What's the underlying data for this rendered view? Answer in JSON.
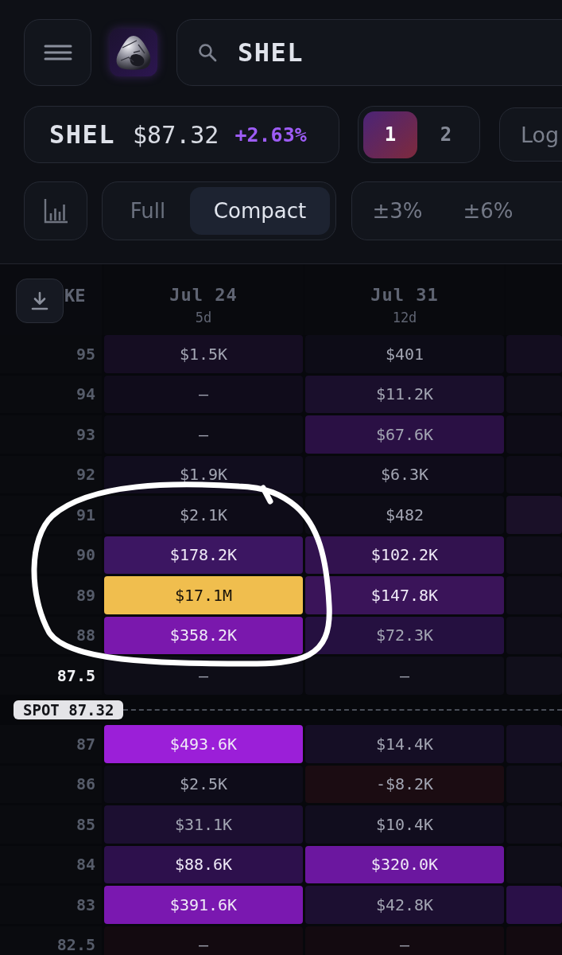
{
  "search": {
    "value": "SHEL"
  },
  "quote": {
    "symbol": "SHEL",
    "price": "$87.32",
    "change": "+2.63%"
  },
  "pages": [
    {
      "label": "1",
      "selected": true
    },
    {
      "label": "2",
      "selected": false
    }
  ],
  "header_button": {
    "label": "Log"
  },
  "view_modes": [
    {
      "label": "Full",
      "selected": false
    },
    {
      "label": "Compact",
      "selected": true
    }
  ],
  "ranges": [
    {
      "label": "±3%",
      "selected": false
    },
    {
      "label": "±6%",
      "selected": false
    }
  ],
  "table": {
    "strike_header": "KE",
    "columns": [
      {
        "date": "Jul 24",
        "days": "5d"
      },
      {
        "date": "Jul 31",
        "days": "12d"
      }
    ],
    "rows": [
      {
        "kind": "strike",
        "strike": "95",
        "highlighted": false,
        "cells": [
          {
            "value": "$1.5K",
            "color": "#150d22"
          },
          {
            "value": "$401",
            "color": "#0d0c17"
          },
          {
            "color": "#130d1f"
          }
        ]
      },
      {
        "kind": "strike",
        "strike": "94",
        "highlighted": false,
        "cells": [
          {
            "value": "—",
            "color": "#100c1b"
          },
          {
            "value": "$11.2K",
            "color": "#1a0f2c"
          },
          {
            "color": "#0f0d18"
          }
        ]
      },
      {
        "kind": "strike",
        "strike": "93",
        "highlighted": false,
        "cells": [
          {
            "value": "—",
            "color": "#0d0c16"
          },
          {
            "value": "$67.6K",
            "color": "#2a1044"
          },
          {
            "color": "#0e0c17"
          }
        ]
      },
      {
        "kind": "strike",
        "strike": "92",
        "highlighted": false,
        "cells": [
          {
            "value": "$1.9K",
            "color": "#110d1e"
          },
          {
            "value": "$6.3K",
            "color": "#0f0c1a"
          },
          {
            "color": "#0e0c17"
          }
        ]
      },
      {
        "kind": "strike",
        "strike": "91",
        "highlighted": false,
        "cells": [
          {
            "value": "$2.1K",
            "color": "#0e0c18"
          },
          {
            "value": "$482",
            "color": "#0d0c16"
          },
          {
            "color": "#1a1028"
          }
        ]
      },
      {
        "kind": "strike",
        "strike": "90",
        "highlighted": false,
        "cells": [
          {
            "value": "$178.2K",
            "color": "#3c1662"
          },
          {
            "value": "$102.2K",
            "color": "#32124f"
          },
          {
            "color": "#0f0d18"
          }
        ]
      },
      {
        "kind": "strike",
        "strike": "89",
        "highlighted": false,
        "cells": [
          {
            "value": "$17.1M",
            "color": "#f0be4e"
          },
          {
            "value": "$147.8K",
            "color": "#3a1459"
          },
          {
            "color": "#0f0d18"
          }
        ]
      },
      {
        "kind": "strike",
        "strike": "88",
        "highlighted": false,
        "cells": [
          {
            "value": "$358.2K",
            "color": "#7a18ad"
          },
          {
            "value": "$72.3K",
            "color": "#251040"
          },
          {
            "color": "#0f0d18"
          }
        ]
      },
      {
        "kind": "strike",
        "strike": "87.5",
        "highlighted": true,
        "cells": [
          {
            "value": "—",
            "color": "#0e0d17"
          },
          {
            "value": "—",
            "color": "#0e0d17"
          },
          {
            "color": "#110f1b"
          }
        ]
      },
      {
        "kind": "spot",
        "label": "SPOT 87.32"
      },
      {
        "kind": "strike",
        "strike": "87",
        "highlighted": false,
        "cells": [
          {
            "value": "$493.6K",
            "color": "#9b1fd8"
          },
          {
            "value": "$14.4K",
            "color": "#150e25"
          },
          {
            "color": "#140e22"
          }
        ]
      },
      {
        "kind": "strike",
        "strike": "86",
        "highlighted": false,
        "cells": [
          {
            "value": "$2.5K",
            "color": "#0e0c19"
          },
          {
            "value": "-$8.2K",
            "color": "#1b0c12"
          },
          {
            "color": "#0f0d18"
          }
        ]
      },
      {
        "kind": "strike",
        "strike": "85",
        "highlighted": false,
        "cells": [
          {
            "value": "$31.1K",
            "color": "#1c0f31"
          },
          {
            "value": "$10.4K",
            "color": "#110d1e"
          },
          {
            "color": "#0f0d18"
          }
        ]
      },
      {
        "kind": "strike",
        "strike": "84",
        "highlighted": false,
        "cells": [
          {
            "value": "$88.6K",
            "color": "#2d104c"
          },
          {
            "value": "$320.0K",
            "color": "#6b179f"
          },
          {
            "color": "#0f0d18"
          }
        ]
      },
      {
        "kind": "strike",
        "strike": "83",
        "highlighted": false,
        "cells": [
          {
            "value": "$391.6K",
            "color": "#7a18b0"
          },
          {
            "value": "$42.8K",
            "color": "#1c0f31"
          },
          {
            "color": "#2a1048"
          }
        ]
      },
      {
        "kind": "strike",
        "strike": "82.5",
        "highlighted": false,
        "cells": [
          {
            "value": "—",
            "color": "#130a10"
          },
          {
            "value": "—",
            "color": "#130a10"
          },
          {
            "color": "#130a10"
          }
        ]
      }
    ]
  }
}
